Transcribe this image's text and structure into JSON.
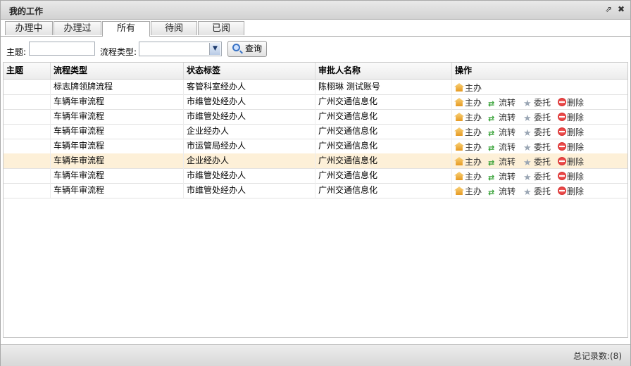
{
  "window": {
    "title": "我的工作",
    "popout_icon": "⇗",
    "close_icon": "✖"
  },
  "tabs": [
    {
      "label": "办理中",
      "active": false
    },
    {
      "label": "办理过",
      "active": false
    },
    {
      "label": "所有",
      "active": true
    },
    {
      "label": "待阅",
      "active": false
    },
    {
      "label": "已阅",
      "active": false
    }
  ],
  "search": {
    "subject_label": "主题:",
    "subject_value": "",
    "flow_type_label": "流程类型:",
    "flow_type_value": "",
    "query_button": "查询"
  },
  "grid": {
    "columns": [
      "主题",
      "流程类型",
      "状态标签",
      "审批人名称",
      "操作"
    ],
    "rows": [
      {
        "subject": "",
        "flow_type": "标志牌领牌流程",
        "status": "客管科室经办人",
        "approver": "陈栩琳 测试账号",
        "actions": [
          "主办"
        ],
        "selected": false
      },
      {
        "subject": "",
        "flow_type": "车辆年审流程",
        "status": "市维管处经办人",
        "approver": "广州交通信息化",
        "actions": [
          "主办",
          "流转",
          "委托",
          "删除"
        ],
        "selected": false
      },
      {
        "subject": "",
        "flow_type": "车辆年审流程",
        "status": "市维管处经办人",
        "approver": "广州交通信息化",
        "actions": [
          "主办",
          "流转",
          "委托",
          "删除"
        ],
        "selected": false
      },
      {
        "subject": "",
        "flow_type": "车辆年审流程",
        "status": "企业经办人",
        "approver": "广州交通信息化",
        "actions": [
          "主办",
          "流转",
          "委托",
          "删除"
        ],
        "selected": false
      },
      {
        "subject": "",
        "flow_type": "车辆年审流程",
        "status": "市运管局经办人",
        "approver": "广州交通信息化",
        "actions": [
          "主办",
          "流转",
          "委托",
          "删除"
        ],
        "selected": false
      },
      {
        "subject": "",
        "flow_type": "车辆年审流程",
        "status": "企业经办人",
        "approver": "广州交通信息化",
        "actions": [
          "主办",
          "流转",
          "委托",
          "删除"
        ],
        "selected": true
      },
      {
        "subject": "",
        "flow_type": "车辆年审流程",
        "status": "市维管处经办人",
        "approver": "广州交通信息化",
        "actions": [
          "主办",
          "流转",
          "委托",
          "删除"
        ],
        "selected": false
      },
      {
        "subject": "",
        "flow_type": "车辆年审流程",
        "status": "市维管处经办人",
        "approver": "广州交通信息化",
        "actions": [
          "主办",
          "流转",
          "委托",
          "删除"
        ],
        "selected": false
      }
    ]
  },
  "footer": {
    "total_label": "总记录数:(8)"
  }
}
